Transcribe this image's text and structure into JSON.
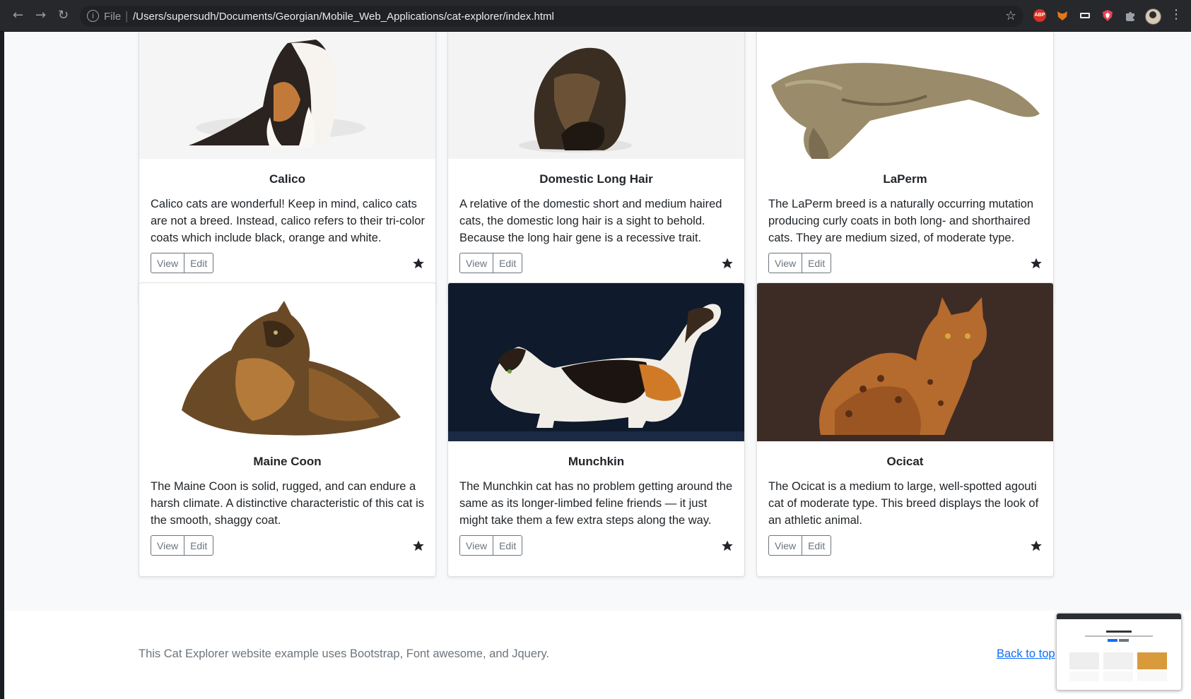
{
  "browser": {
    "scheme_label": "File",
    "url": "/Users/supersudh/Documents/Georgian/Mobile_Web_Applications/cat-explorer/index.html",
    "abp_label": "ABP"
  },
  "cards": [
    {
      "title": "Calico",
      "text": "Calico cats are wonderful! Keep in mind, calico cats are not a breed. Instead, calico refers to their tri-color coats which include black, orange and white.",
      "view_label": "View",
      "edit_label": "Edit"
    },
    {
      "title": "Domestic Long Hair",
      "text": "A relative of the domestic short and medium haired cats, the domestic long hair is a sight to behold. Because the long hair gene is a recessive trait.",
      "view_label": "View",
      "edit_label": "Edit"
    },
    {
      "title": "LaPerm",
      "text": "The LaPerm breed is a naturally occurring mutation producing curly coats in both long- and shorthaired cats. They are medium sized, of moderate type.",
      "view_label": "View",
      "edit_label": "Edit"
    },
    {
      "title": "Maine Coon",
      "text": "The Maine Coon is solid, rugged, and can endure a harsh climate. A distinctive characteristic of this cat is the smooth, shaggy coat.",
      "view_label": "View",
      "edit_label": "Edit"
    },
    {
      "title": "Munchkin",
      "text": "The Munchkin cat has no problem getting around the same as its longer-limbed feline friends — it just might take them a few extra steps along the way.",
      "view_label": "View",
      "edit_label": "Edit"
    },
    {
      "title": "Ocicat",
      "text": "The Ocicat is a medium to large, well-spotted agouti cat of moderate type. This breed displays the look of an athletic animal.",
      "view_label": "View",
      "edit_label": "Edit"
    }
  ],
  "footer": {
    "text": "This Cat Explorer website example uses Bootstrap, Font awesome, and Jquery.",
    "back_to_top": "Back to top"
  },
  "colors": {
    "page_bg": "#f8f9fa",
    "link": "#0d6efd",
    "button_outline": "#6c757d",
    "star": "#212529"
  }
}
